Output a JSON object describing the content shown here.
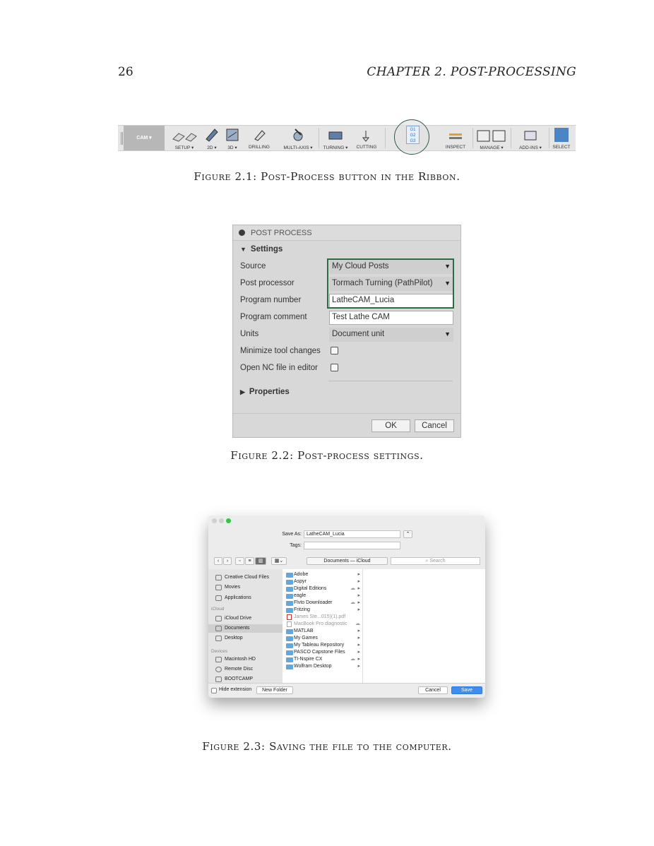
{
  "page": {
    "number": "26",
    "running_head": "CHAPTER 2.  POST-PROCESSING"
  },
  "ribbon": {
    "cam": "CAM ▾",
    "groups": [
      "SETUP ▾",
      "2D ▾",
      "3D ▾",
      "DRILLING",
      "MULTI-AXIS ▾",
      "TURNING ▾",
      "CUTTING",
      "INSPECT",
      "MANAGE ▾",
      "ADD-INS ▾",
      "SELECT"
    ],
    "gcode": [
      "G1",
      "G2",
      "G3"
    ]
  },
  "captions": {
    "fig1": "Figure 2.1: Post-Process button in the Ribbon.",
    "fig2": "Figure 2.2: Post-process settings.",
    "fig3": "Figure 2.3: Saving the file to the computer."
  },
  "post_process": {
    "title": "POST PROCESS",
    "settings": "Settings",
    "source_label": "Source",
    "source_value": "My Cloud Posts",
    "post_label": "Post processor",
    "post_value": "Tormach Turning (PathPilot)",
    "program_number_label": "Program number",
    "program_number_value": "LatheCAM_Lucia",
    "program_comment_label": "Program comment",
    "program_comment_value": "Test Lathe CAM",
    "units_label": "Units",
    "units_value": "Document unit",
    "minimize_label": "Minimize tool changes",
    "opennc_label": "Open NC file in editor",
    "properties": "Properties",
    "ok": "OK",
    "cancel": "Cancel"
  },
  "save_dialog": {
    "save_as_label": "Save As:",
    "save_as_value": "LatheCAM_Lucia",
    "tags_label": "Tags:",
    "location": "Documents — iCloud",
    "search_placeholder": "Search",
    "sidebar": {
      "favorites": [
        "Creative Cloud Files",
        "Movies",
        "Applications"
      ],
      "icloud_header": "iCloud",
      "icloud": [
        "iCloud Drive",
        "Documents",
        "Desktop"
      ],
      "devices_header": "Devices",
      "devices": [
        "Macintosh HD",
        "Remote Disc",
        "BOOTCAMP"
      ]
    },
    "files": [
      "Adobe",
      "Aspyr",
      "Digital Editions",
      "eagle",
      "Flvto Downloader",
      "Fritzing",
      "James Ste...015)(1).pdf",
      "MacBook Pro diagnostic",
      "MATLAB",
      "My Games",
      "My Tableau Repository",
      "PASCO Capstone Files",
      "TI-Nspire CX",
      "Wolfram Desktop"
    ],
    "hide_extension": "Hide extension",
    "new_folder": "New Folder",
    "cancel": "Cancel",
    "save": "Save"
  },
  "colors": {
    "highlight": "#2e6b43",
    "save_button": "#3d8ef0",
    "folder": "#5fa8e0"
  }
}
